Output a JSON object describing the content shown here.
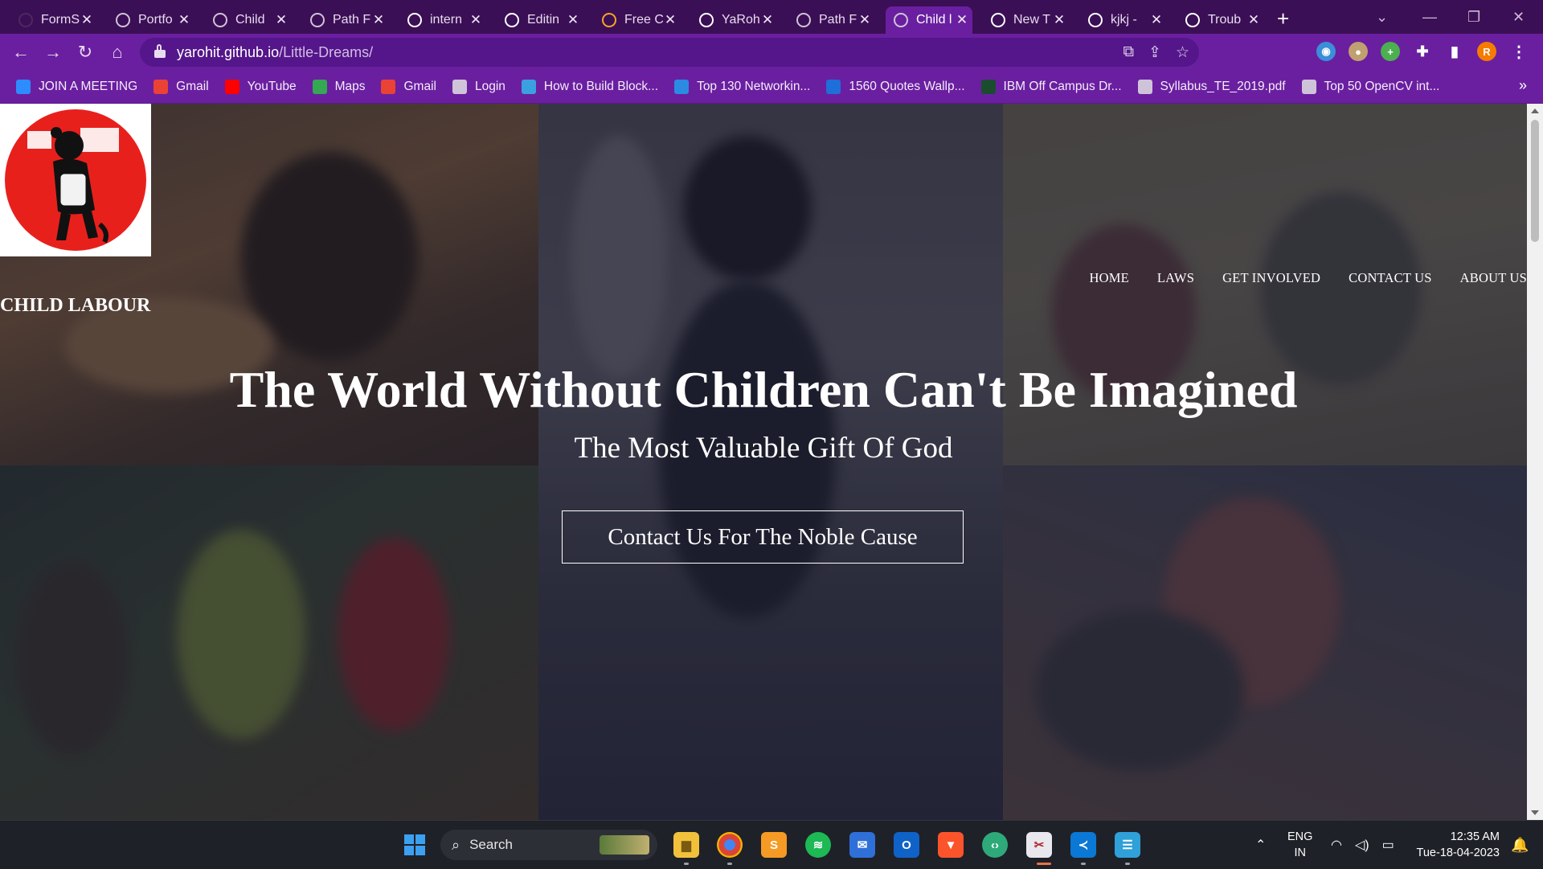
{
  "browser": {
    "tabs": [
      {
        "label": "FormS",
        "favicon": "formspree-icon",
        "color": "#4a2a60"
      },
      {
        "label": "Portfo",
        "favicon": "globe-icon",
        "color": "#cfc3d9"
      },
      {
        "label": "Child",
        "favicon": "globe-icon",
        "color": "#cfc3d9"
      },
      {
        "label": "Path F",
        "favicon": "globe-icon",
        "color": "#cfc3d9"
      },
      {
        "label": "intern",
        "favicon": "github-icon",
        "color": "#ffffff"
      },
      {
        "label": "Editin",
        "favicon": "github-icon",
        "color": "#ffffff"
      },
      {
        "label": "Free C",
        "favicon": "s-icon",
        "color": "#f5a623"
      },
      {
        "label": "YaRoh",
        "favicon": "github-icon",
        "color": "#ffffff"
      },
      {
        "label": "Path F",
        "favicon": "globe-icon",
        "color": "#cfc3d9"
      },
      {
        "label": "Child l",
        "favicon": "globe-icon",
        "color": "#cfc3d9",
        "active": true
      },
      {
        "label": "New T",
        "favicon": "chrome-icon",
        "color": "#ffffff"
      },
      {
        "label": "kjkj -",
        "favicon": "google-icon",
        "color": "#ffffff"
      },
      {
        "label": "Troub",
        "favicon": "github-icon",
        "color": "#ffffff"
      }
    ],
    "url_host": "yarohit.github.io",
    "url_path": "/Little-Dreams/",
    "bookmarks": [
      {
        "label": "JOIN A MEETING",
        "icon": "zoom-icon",
        "color": "#2d8cff"
      },
      {
        "label": "Gmail",
        "icon": "gmail-icon",
        "color": "#ea4335"
      },
      {
        "label": "YouTube",
        "icon": "youtube-icon",
        "color": "#ff0000"
      },
      {
        "label": "Maps",
        "icon": "maps-icon",
        "color": "#34a853"
      },
      {
        "label": "Gmail",
        "icon": "gmail-icon",
        "color": "#ea4335"
      },
      {
        "label": "Login",
        "icon": "globe-icon",
        "color": "#cfc3d9"
      },
      {
        "label": "How to Build Block...",
        "icon": "blockchain-icon",
        "color": "#3aa0e0"
      },
      {
        "label": "Top 130 Networkin...",
        "icon": "k-icon",
        "color": "#2b8ae2"
      },
      {
        "label": "1560 Quotes Wallp...",
        "icon": "b-icon",
        "color": "#1e6fd9"
      },
      {
        "label": "IBM Off Campus Dr...",
        "icon": "fv-icon",
        "color": "#1a4d2e"
      },
      {
        "label": "Syllabus_TE_2019.pdf",
        "icon": "globe-icon",
        "color": "#cfc3d9"
      },
      {
        "label": "Top 50 OpenCV int...",
        "icon": "globe-icon",
        "color": "#cfc3d9"
      }
    ],
    "profile_initial": "R",
    "accent": "#6a1fa0"
  },
  "site": {
    "brand": "CHILD LABOUR",
    "nav": [
      "HOME",
      "LAWS",
      "GET INVOLVED",
      "CONTACT US",
      "ABOUT US"
    ],
    "hero_title": "The World Without Children Can't Be Imagined",
    "hero_subtitle": "The Most Valuable Gift Of God",
    "cta_label": "Contact Us For The Noble Cause"
  },
  "taskbar": {
    "search_label": "Search",
    "lang_line1": "ENG",
    "lang_line2": "IN",
    "time": "12:35 AM",
    "date": "Tue-18-04-2023"
  }
}
